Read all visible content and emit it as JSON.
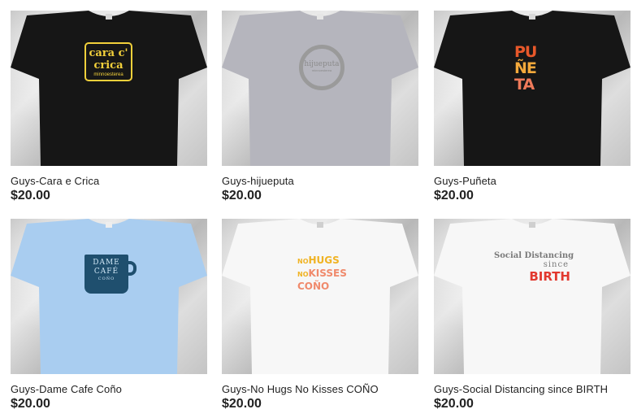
{
  "products": [
    {
      "title": "Guys-Cara e Crica",
      "price": "$20.00",
      "shirt_color": "#161616",
      "design": {
        "line1": "cara c'",
        "line2": "crica",
        "line3": "minnoesterea"
      }
    },
    {
      "title": "Guys-hijueputa",
      "price": "$20.00",
      "shirt_color": "#b5b5bd",
      "design": {
        "line1": "hijueputa",
        "line2": "minnoesterea"
      }
    },
    {
      "title": "Guys-Puñeta",
      "price": "$20.00",
      "shirt_color": "#161616",
      "design": {
        "line1": "PU",
        "line2": "ÑE",
        "line3": "TA"
      }
    },
    {
      "title": "Guys-Dame Cafe Coño",
      "price": "$20.00",
      "shirt_color": "#a9cdf0",
      "design": {
        "line1": "DAME",
        "line2": "CAFÉ",
        "line3": "COÑO"
      }
    },
    {
      "title": "Guys-No Hugs No Kisses COÑO",
      "price": "$20.00",
      "shirt_color": "#f7f7f7",
      "design": {
        "no1": "NO",
        "line1": "HUGS",
        "no2": "NO",
        "line2": "KISSES",
        "line3": "COÑO"
      }
    },
    {
      "title": "Guys-Social Distancing since BIRTH",
      "price": "$20.00",
      "shirt_color": "#f7f7f7",
      "design": {
        "line1": "Social Distancing",
        "line2": "since",
        "line3": "BIRTH"
      }
    }
  ]
}
